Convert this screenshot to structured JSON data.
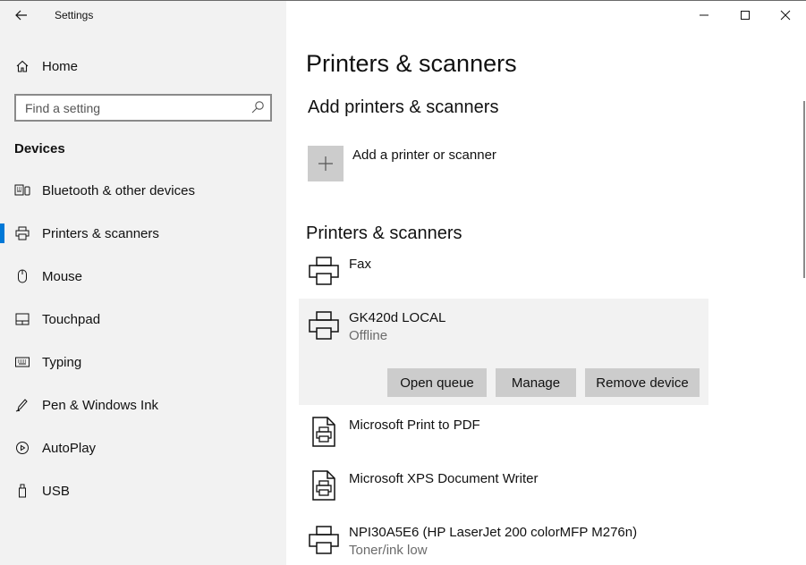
{
  "window": {
    "title": "Settings",
    "controls": [
      "minimize",
      "maximize",
      "close"
    ]
  },
  "sidebar": {
    "home_label": "Home",
    "search": {
      "placeholder": "Find a setting"
    },
    "section": "Devices",
    "items": [
      {
        "label": "Bluetooth & other devices",
        "icon": "bluetooth-devices-icon",
        "selected": false
      },
      {
        "label": "Printers & scanners",
        "icon": "printer-icon",
        "selected": true
      },
      {
        "label": "Mouse",
        "icon": "mouse-icon",
        "selected": false
      },
      {
        "label": "Touchpad",
        "icon": "touchpad-icon",
        "selected": false
      },
      {
        "label": "Typing",
        "icon": "keyboard-icon",
        "selected": false
      },
      {
        "label": "Pen & Windows Ink",
        "icon": "pen-icon",
        "selected": false
      },
      {
        "label": "AutoPlay",
        "icon": "autoplay-icon",
        "selected": false
      },
      {
        "label": "USB",
        "icon": "usb-icon",
        "selected": false
      }
    ]
  },
  "main": {
    "title": "Printers & scanners",
    "add_section": {
      "title": "Add printers & scanners",
      "add_label": "Add a printer or scanner"
    },
    "list_section": {
      "title": "Printers & scanners",
      "devices": [
        {
          "name": "Fax",
          "status": "",
          "icon": "printer-icon"
        },
        {
          "name": "GK420d LOCAL",
          "status": "Offline",
          "icon": "printer-icon",
          "selected": true,
          "actions": {
            "open_queue": "Open queue",
            "manage": "Manage",
            "remove": "Remove device"
          }
        },
        {
          "name": "Microsoft Print to PDF",
          "status": "",
          "icon": "document-printer-icon"
        },
        {
          "name": "Microsoft XPS Document Writer",
          "status": "",
          "icon": "document-printer-icon"
        },
        {
          "name": "NPI30A5E6 (HP LaserJet 200 colorMFP M276n)",
          "status": "Toner/ink low",
          "icon": "printer-icon"
        }
      ]
    }
  },
  "colors": {
    "accent": "#0078d7",
    "sidebar_bg": "#f2f2f2",
    "button_bg": "#cccccc",
    "secondary_text": "#6b6b6b"
  }
}
